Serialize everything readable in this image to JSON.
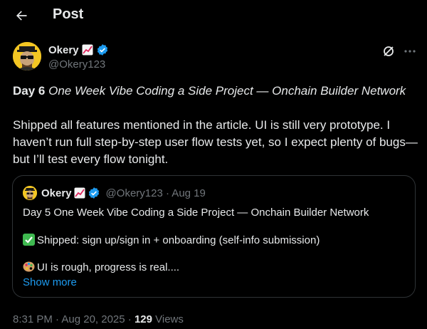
{
  "header": {
    "title": "Post",
    "back_icon": "arrow-left-icon"
  },
  "author": {
    "display_name": "Okery",
    "handle": "@Okery123",
    "badge": "chart-increasing-emoji",
    "verified_icon": "verified-badge-icon",
    "verified_color": "#1d9bf0"
  },
  "actions": {
    "grok_icon": "grok-icon",
    "more_icon": "more-icon"
  },
  "tweet": {
    "day": "Day 6",
    "title": "One Week Vibe Coding a Side Project — Onchain Builder Network",
    "body": "Shipped all features mentioned in the article. UI is still very prototype. I haven’t run full step-by-step user flow tests yet, so I expect plenty of bugs—but I’ll test every flow tonight."
  },
  "quote": {
    "display_name": "Okery",
    "handle_date": "@Okery123 · Aug 19",
    "line1": "Day 5 One Week Vibe Coding a Side Project — Onchain Builder Network",
    "line2": "Shipped: sign up/sign in + onboarding (self-info submission)",
    "line3": "UI is rough, progress is real....",
    "show_more": "Show more"
  },
  "meta": {
    "timestamp": "8:31 PM · Aug 20, 2025 · ",
    "view_count": "129",
    "views_label": " Views"
  },
  "colors": {
    "background": "#000000",
    "text": "#e7e9ea",
    "muted": "#71767b",
    "accent": "#1d9bf0",
    "border": "#2f3336"
  }
}
